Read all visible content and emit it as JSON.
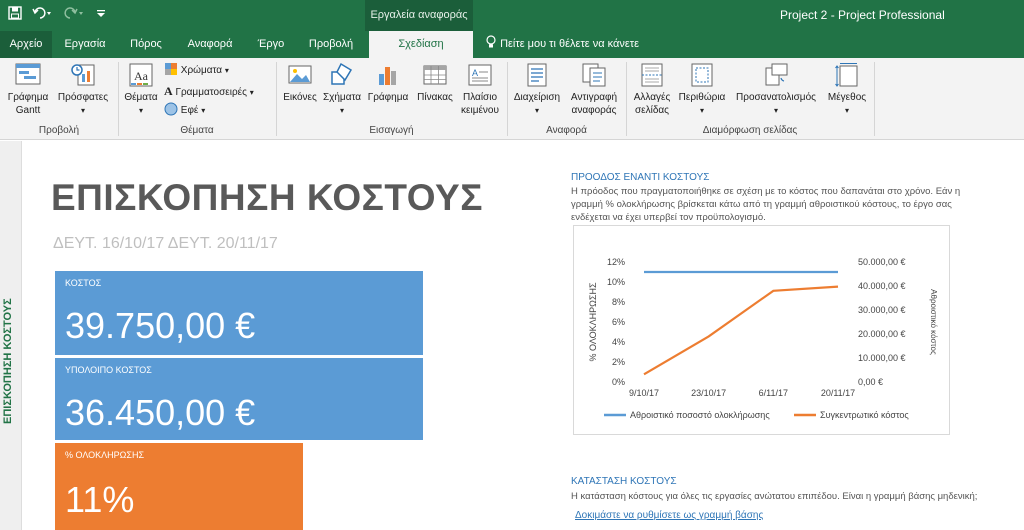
{
  "window": {
    "title": "Project 2  -  Project Professional",
    "context_tab": "Εργαλεία αναφοράς"
  },
  "tabs": [
    {
      "label": "Αρχείο"
    },
    {
      "label": "Εργασία"
    },
    {
      "label": "Πόρος"
    },
    {
      "label": "Αναφορά"
    },
    {
      "label": "Έργο"
    },
    {
      "label": "Προβολή"
    },
    {
      "label": "Σχεδίαση"
    }
  ],
  "tell_me": "Πείτε μου τι θέλετε να κάνετε",
  "ribbon": {
    "gantt_line1": "Γράφημα",
    "gantt_line2": "Gantt",
    "recent": "Πρόσφατες",
    "themes": "Θέματα",
    "colors": "Χρώματα",
    "fonts": "Γραμματοσειρές",
    "effects": "Εφέ",
    "images": "Εικόνες",
    "shapes": "Σχήματα",
    "chart": "Γράφημα",
    "table": "Πίνακας",
    "textbox_line1": "Πλαίσιο",
    "textbox_line2": "κειμένου",
    "manage": "Διαχείριση",
    "copy_line1": "Αντιγραφή",
    "copy_line2": "αναφοράς",
    "breaks_line1": "Αλλαγές",
    "breaks_line2": "σελίδας",
    "margins": "Περιθώρια",
    "orientation": "Προσανατολισμός",
    "size": "Μέγεθος",
    "groups": {
      "view": "Προβολή",
      "themes": "Θέματα",
      "insert": "Εισαγωγή",
      "report": "Αναφορά",
      "page_setup": "Διαμόρφωση σελίδας"
    }
  },
  "sidebar": {
    "label": "ΕΠΙΣΚΟΠΗΣΗ ΚΟΣΤΟΥΣ"
  },
  "report": {
    "title": "ΕΠΙΣΚΟΠΗΣΗ ΚΟΣΤΟΥΣ",
    "dates": "ΔΕΥΤ. 16/10/17  ΔΕΥΤ. 20/11/17",
    "tiles": [
      {
        "label": "ΚΟΣΤΟΣ",
        "value": "39.750,00 €",
        "color": "#5b9bd5"
      },
      {
        "label": "ΥΠΟΛΟΙΠΟ ΚΟΣΤΟΣ",
        "value": "36.450,00 €",
        "color": "#5b9bd5"
      },
      {
        "label": "% ΟΛΟΚΛΗΡΩΣΗΣ",
        "value": "11%",
        "color": "#ed7d31"
      }
    ],
    "progress_section": {
      "title": "ΠΡΟΟΔΟΣ ΕΝΑΝΤΙ ΚΟΣΤΟΥΣ",
      "line1": "Η πρόοδος που πραγματοποιήθηκε σε σχέση με το κόστος που δαπανάται στο χρόνο. Εάν η",
      "line2": "γραμμή % ολοκλήρωσης βρίσκεται κάτω από τη γραμμή αθροιστικού κόστους, το έργο σας",
      "line3": "ενδέχεται να έχει υπερβεί τον προϋπολογισμό."
    },
    "status_section": {
      "title": "ΚΑΤΑΣΤΑΣΗ ΚΟΣΤΟΥΣ",
      "text": "Η κατάσταση κόστους για όλες τις εργασίες ανώτατου επιπέδου. Είναι η γραμμή βάσης μηδενική;",
      "link": "Δοκιμάστε να ρυθμίσετε ως γραμμή βάσης"
    }
  },
  "chart_data": {
    "type": "line",
    "categories": [
      "9/10/17",
      "23/10/17",
      "6/11/17",
      "20/11/17"
    ],
    "ylabel": "% ΟΛΟΚΛΗΡΩΣΗΣ",
    "y2label": "Αθροιστικό κόστος",
    "y_ticks": [
      "0%",
      "2%",
      "4%",
      "6%",
      "8%",
      "10%",
      "12%"
    ],
    "y2_ticks": [
      "0,00 €",
      "10.000,00 €",
      "20.000,00 €",
      "30.000,00 €",
      "40.000,00 €",
      "50.000,00 €"
    ],
    "ylim": [
      0,
      12
    ],
    "y2lim": [
      0,
      50000
    ],
    "legend_position": "bottom",
    "series": [
      {
        "name": "Αθροιστικό ποσοστό ολοκλήρωσης",
        "axis": "left",
        "color": "#5b9bd5",
        "values": [
          11,
          11,
          11,
          11
        ]
      },
      {
        "name": "Συγκεντρωτικό κόστος",
        "axis": "right",
        "color": "#ed7d31",
        "values": [
          3200,
          19000,
          38000,
          39750
        ]
      }
    ]
  }
}
